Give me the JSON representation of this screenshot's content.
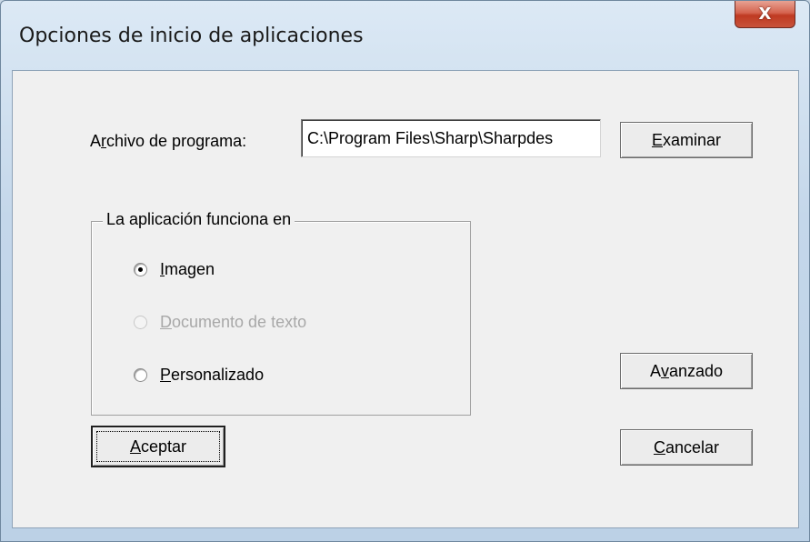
{
  "window": {
    "title": "Opciones de inicio de aplicaciones",
    "close_glyph": "X"
  },
  "program_file": {
    "label_pre": "A",
    "label_mnemonic": "r",
    "label_post": "chivo de programa:",
    "value": "C:\\Program Files\\Sharp\\Sharpdes"
  },
  "buttons": {
    "browse": {
      "pre": "",
      "mnemonic": "E",
      "post": "xaminar"
    },
    "advanced": {
      "pre": "A",
      "mnemonic": "v",
      "post": "anzado"
    },
    "cancel": {
      "pre": "",
      "mnemonic": "C",
      "post": "ancelar"
    },
    "ok": {
      "pre": "",
      "mnemonic": "A",
      "post": "ceptar"
    }
  },
  "group": {
    "legend": "La aplicación funciona en",
    "options": [
      {
        "pre": "",
        "mnemonic": "I",
        "post": "magen",
        "checked": true,
        "enabled": true
      },
      {
        "pre": "",
        "mnemonic": "D",
        "post": "ocumento de texto",
        "checked": false,
        "enabled": false
      },
      {
        "pre": "",
        "mnemonic": "P",
        "post": "ersonalizado",
        "checked": false,
        "enabled": true
      }
    ]
  },
  "colors": {
    "close_button": "#c8533a",
    "dialog_background": "#f0f0f0",
    "disabled_text": "#a8a8a8"
  }
}
